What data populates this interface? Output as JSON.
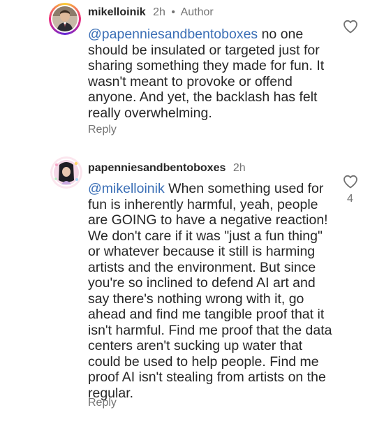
{
  "comments": [
    {
      "username": "mikelloinik",
      "time": "2h",
      "separator": "•",
      "badge": "Author",
      "mention": "@papenniesandbentoboxes",
      "text": " no one should be insulated or targeted just for sharing something they made for fun. It wasn't meant to provoke or offend anyone. And yet, the backlash has felt really overwhelming.",
      "reply_label": "Reply",
      "likes": ""
    },
    {
      "username": "papenniesandbentoboxes",
      "time": "2h",
      "mention": "@mikelloinik",
      "text": " When something used for fun is inherently harmful, yeah, people are GOING to have a negative reaction! We don't care if it was \"just a fun thing\" or whatever because it still is harming artists and the environment. But since you're so inclined to defend AI art and say there's nothing wrong with it, go ahead and find me tangible proof that it isn't harmful. Find me proof that the data centers aren't sucking up water that could be used to help people. Find me proof AI isn't stealing from artists on the regular.",
      "reply_label": "Reply",
      "likes": "4"
    }
  ],
  "icons": {
    "like": "heart-outline-icon"
  },
  "colors": {
    "mention": "#3b6fb6",
    "secondary_text": "#737373",
    "primary_text": "#262626"
  }
}
